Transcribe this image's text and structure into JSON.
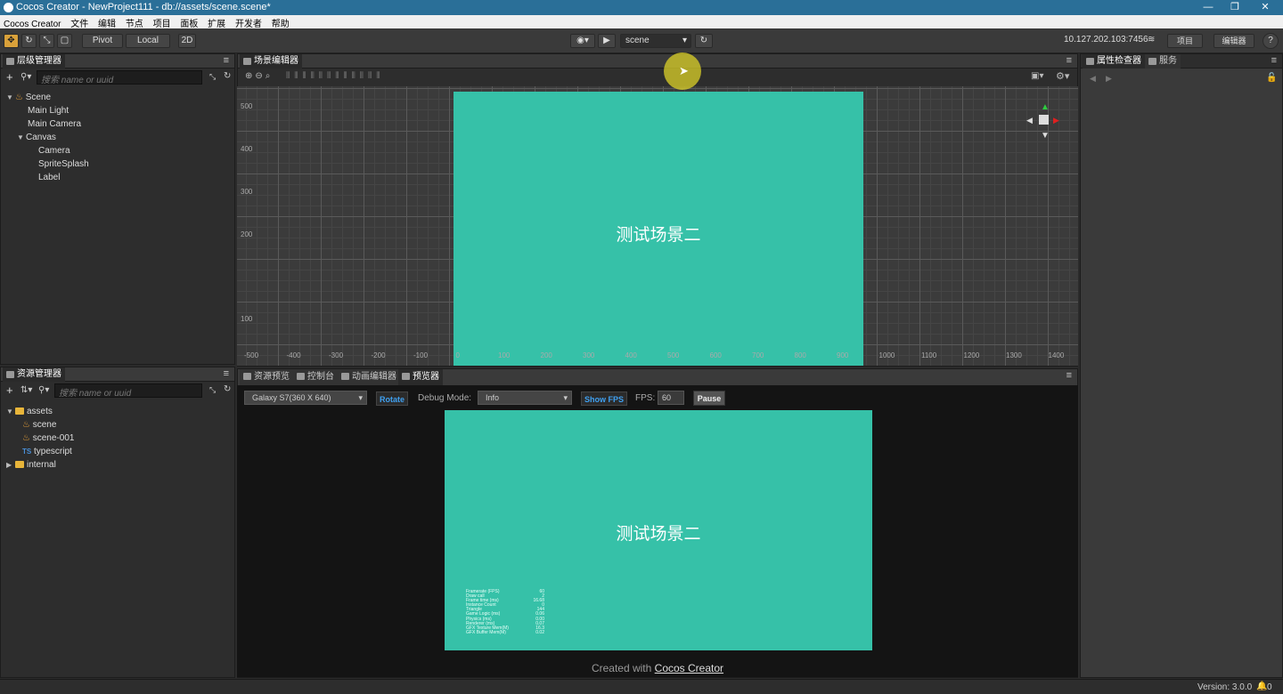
{
  "window": {
    "title": "Cocos Creator - NewProject111 - db://assets/scene.scene*",
    "controls": [
      "—",
      "❐",
      "✕"
    ]
  },
  "menu": [
    "Cocos Creator",
    "文件",
    "编辑",
    "节点",
    "项目",
    "面板",
    "扩展",
    "开发者",
    "帮助"
  ],
  "toolbar": {
    "pivot_label": "Pivot",
    "local_label": "Local",
    "mode_2d_label": "2D",
    "scene_select_value": "scene",
    "ip_address": "10.127.202.103:7456",
    "project_label": "项目",
    "editor_label": "编辑器",
    "help_label": "?"
  },
  "hierarchy": {
    "title": "层级管理器",
    "search_placeholder": "搜索 name or uuid",
    "nodes": [
      {
        "label": "Scene",
        "depth": 0,
        "expanded": true,
        "icon": "fire"
      },
      {
        "label": "Main Light",
        "depth": 1
      },
      {
        "label": "Main Camera",
        "depth": 1
      },
      {
        "label": "Canvas",
        "depth": 1,
        "expanded": true
      },
      {
        "label": "Camera",
        "depth": 2
      },
      {
        "label": "SpriteSplash",
        "depth": 2
      },
      {
        "label": "Label",
        "depth": 2
      }
    ]
  },
  "assets": {
    "title": "资源管理器",
    "search_placeholder": "搜索 name or uuid",
    "items": [
      {
        "label": "assets",
        "icon": "folder",
        "expanded": true
      },
      {
        "label": "scene",
        "icon": "fire"
      },
      {
        "label": "scene-001",
        "icon": "fire"
      },
      {
        "label": "typescript",
        "icon": "ts"
      },
      {
        "label": "internal",
        "icon": "folder",
        "expanded": false
      }
    ]
  },
  "scene_editor": {
    "title": "场景编辑器",
    "canvas_text": "测试场景二",
    "ruler_y": [
      "500",
      "400",
      "300",
      "200",
      "100"
    ],
    "ruler_x": [
      "-500",
      "-400",
      "-300",
      "-200",
      "-100",
      "0",
      "100",
      "200",
      "300",
      "400",
      "500",
      "600",
      "700",
      "800",
      "900",
      "1000",
      "1100",
      "1200",
      "1300",
      "1400"
    ]
  },
  "bottom_tabs": [
    "资源预览",
    "控制台",
    "动画编辑器",
    "预览器"
  ],
  "preview": {
    "device_select": "Galaxy S7(360 X 640)",
    "rotate_label": "Rotate",
    "debug_mode_label": "Debug Mode:",
    "debug_mode_value": "Info",
    "show_fps_label": "Show FPS",
    "fps_label": "FPS:",
    "fps_value": "60",
    "pause_label": "Pause",
    "canvas_text": "测试场景二",
    "stats": [
      [
        "Framerate (FPS)",
        "60"
      ],
      [
        "Draw call",
        "2"
      ],
      [
        "Frame time (ms)",
        "16.68"
      ],
      [
        "Instance Count",
        "0"
      ],
      [
        "Triangle",
        "144"
      ],
      [
        "Game Logic (ms)",
        "0.06"
      ],
      [
        "Physics (ms)",
        "0.00"
      ],
      [
        "Renderer (ms)",
        "0.07"
      ],
      [
        "GFX Texture Mem(M)",
        "16.3"
      ],
      [
        "GFX Buffer Mem(M)",
        "0.02"
      ]
    ],
    "created_with": "Created with",
    "creator_link": "Cocos Creator"
  },
  "inspector": {
    "tab1": "属性检查器",
    "tab2": "服务"
  },
  "status": {
    "version": "Version: 3.0.0",
    "notifications": "0"
  }
}
